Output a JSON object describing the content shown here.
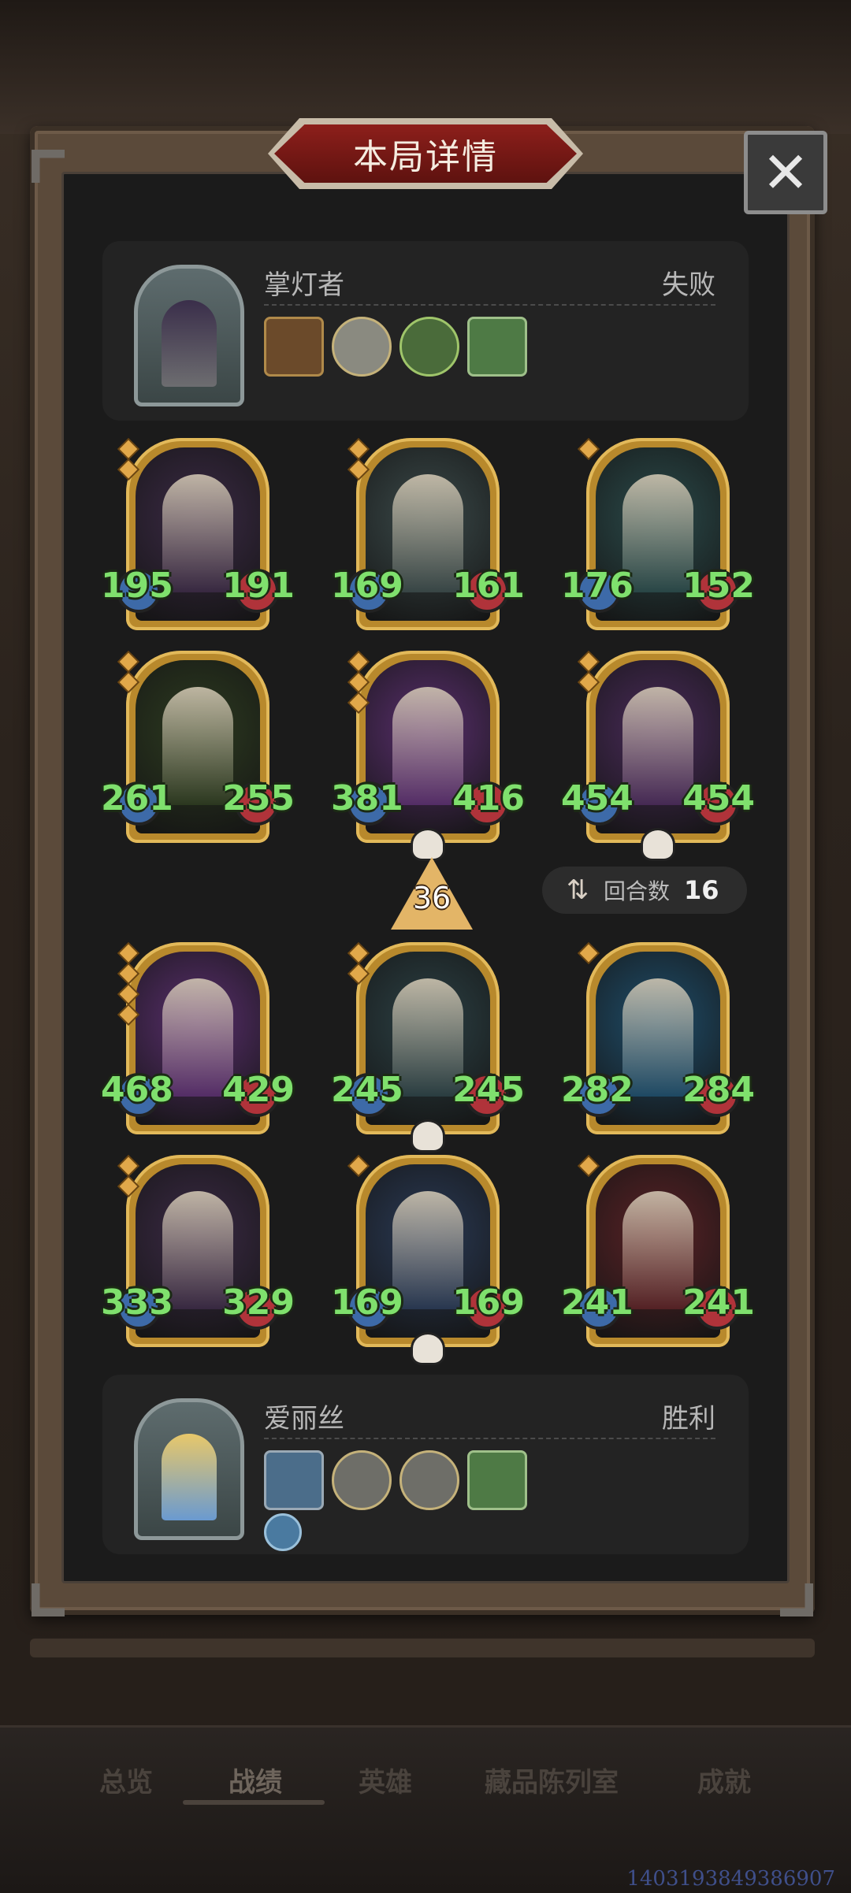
{
  "header": {
    "title": "本局详情"
  },
  "close": {
    "glyph": "✕"
  },
  "opponent": {
    "name": "掌灯者",
    "result": "失败",
    "items": [
      "lantern-relic-icon",
      "compass-trinket-icon",
      "green-orb-icon",
      "green-book-icon"
    ]
  },
  "opponent_board": [
    {
      "attack": "195",
      "health": "191",
      "accent": "#3b2a45"
    },
    {
      "attack": "169",
      "health": "161",
      "accent": "#3b4a4a"
    },
    {
      "attack": "176",
      "health": "152",
      "accent": "#2b4b4b"
    },
    {
      "attack": "261",
      "health": "255",
      "accent": "#2d3b20"
    },
    {
      "attack": "381",
      "health": "416",
      "accent": "#5a2f6e"
    },
    {
      "attack": "454",
      "health": "454",
      "accent": "#4a2b5a"
    }
  ],
  "divider": {
    "level": "36",
    "rounds_label": "回合数",
    "rounds_value": "16",
    "rounds_icon": "⇅"
  },
  "player_board": [
    {
      "attack": "468",
      "health": "429",
      "accent": "#5a2f6e"
    },
    {
      "attack": "245",
      "health": "245",
      "accent": "#2c4145"
    },
    {
      "attack": "282",
      "health": "284",
      "accent": "#1f4e6b"
    },
    {
      "attack": "333",
      "health": "329",
      "accent": "#3b2a45"
    },
    {
      "attack": "169",
      "health": "169",
      "accent": "#2a3a55"
    },
    {
      "attack": "241",
      "health": "241",
      "accent": "#5a2226"
    }
  ],
  "player": {
    "name": "爱丽丝",
    "result": "胜利",
    "items": [
      "mirror-relic-icon",
      "clock-trinket-icon",
      "clock-trinket-icon",
      "green-book-icon",
      "sword-rune-icon"
    ]
  },
  "tabs": [
    {
      "label": "总览"
    },
    {
      "label": "战绩"
    },
    {
      "label": "英雄"
    },
    {
      "label": "藏品陈列室"
    },
    {
      "label": "成就"
    }
  ],
  "footer_id": "1403193849386907",
  "colors": {
    "win": "#b7b7b7",
    "number": "#7fe06d",
    "gold_frame": "#b8892c"
  }
}
